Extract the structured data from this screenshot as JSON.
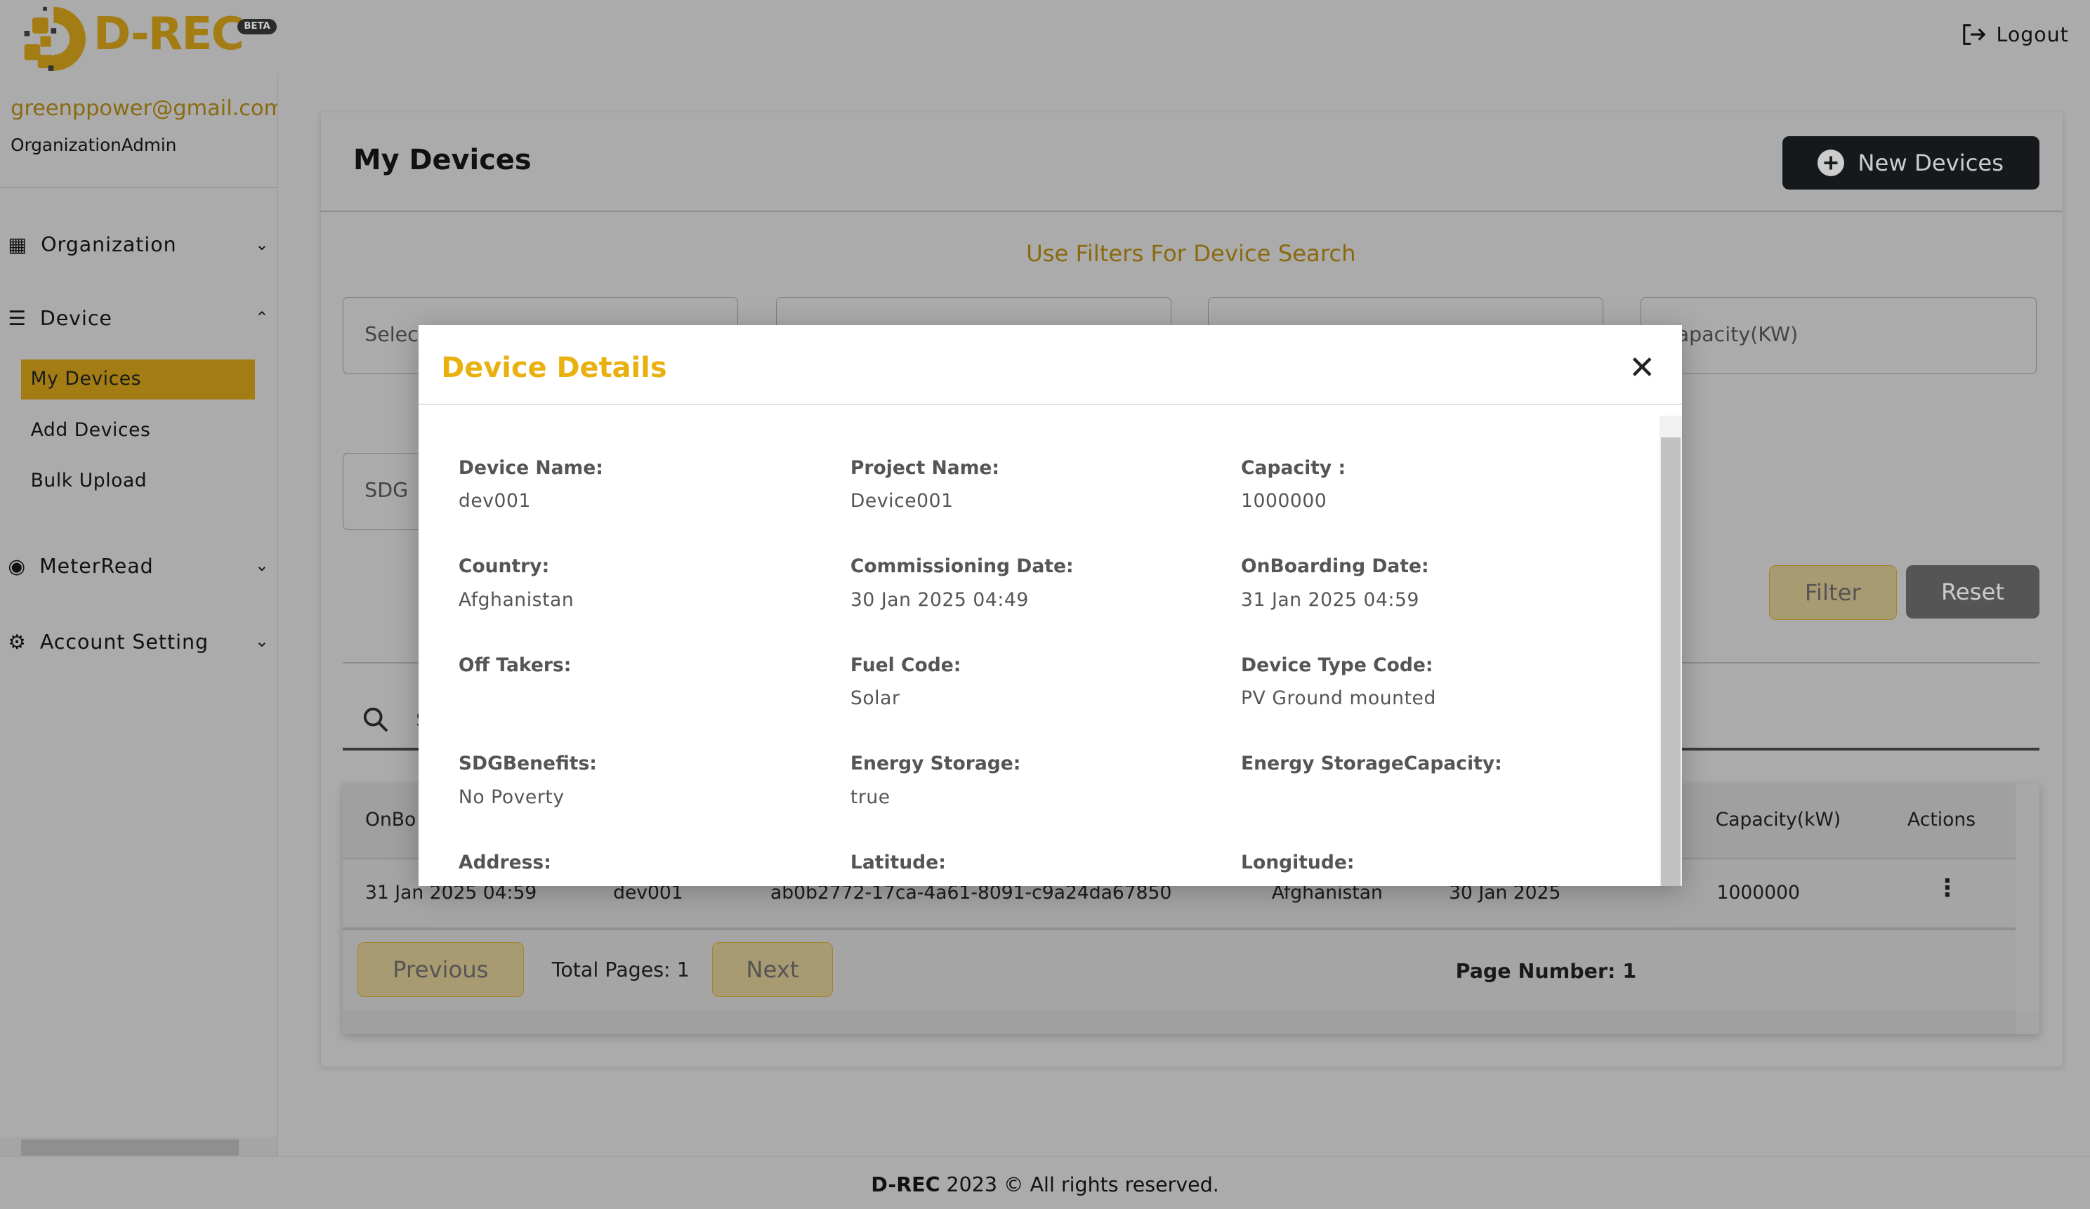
{
  "brand": {
    "name": "D-REC",
    "badge": "BETA"
  },
  "header": {
    "logout": "Logout"
  },
  "user": {
    "email": "greenppower@gmail.com",
    "role": "OrganizationAdmin"
  },
  "sidebar": {
    "items": [
      {
        "label": "Organization",
        "icon": "building-icon",
        "expanded": false
      },
      {
        "label": "Device",
        "icon": "device-icon",
        "expanded": true,
        "children": [
          "My Devices",
          "Add Devices",
          "Bulk Upload"
        ],
        "active": "My Devices"
      },
      {
        "label": "MeterRead",
        "icon": "meter-icon",
        "expanded": false
      },
      {
        "label": "Account Setting",
        "icon": "user-gear-icon",
        "expanded": false
      }
    ]
  },
  "page": {
    "title": "My Devices",
    "new_button": "New Devices",
    "filters_heading": "Use Filters For Device Search",
    "filter_placeholders": [
      "Select",
      "",
      "",
      "Capacity(KW)",
      "SDG"
    ],
    "filter_button": "Filter",
    "reset_button": "Reset",
    "search_placeholder": "S"
  },
  "table": {
    "headers": [
      "OnBoarding Date",
      "",
      "",
      "",
      "",
      "Capacity(kW)",
      "Actions"
    ],
    "header_visible": [
      "OnBo",
      "Capacity(kW)",
      "Actions"
    ],
    "rows": [
      [
        "31 Jan 2025 04:59",
        "dev001",
        "ab0b2772-17ca-4a61-8091-c9a24da67850",
        "Afghanistan",
        "30 Jan 2025",
        "1000000"
      ]
    ],
    "previous": "Previous",
    "total_pages": "Total Pages: 1",
    "next": "Next",
    "page_number_label": "Page Number:",
    "page_number": "1"
  },
  "modal": {
    "title": "Device Details",
    "fields": [
      {
        "label": "Device Name:",
        "value": "dev001"
      },
      {
        "label": "Project Name:",
        "value": "Device001"
      },
      {
        "label": "Capacity :",
        "value": "1000000"
      },
      {
        "label": "Country:",
        "value": "Afghanistan"
      },
      {
        "label": "Commissioning Date:",
        "value": "30 Jan 2025 04:49"
      },
      {
        "label": "OnBoarding Date:",
        "value": "31 Jan 2025 04:59"
      },
      {
        "label": "Off Takers:",
        "value": ""
      },
      {
        "label": "Fuel Code:",
        "value": "Solar"
      },
      {
        "label": "Device Type Code:",
        "value": "PV Ground mounted"
      },
      {
        "label": "SDGBenefits:",
        "value": "No Poverty"
      },
      {
        "label": "Energy Storage:",
        "value": "true"
      },
      {
        "label": "Energy StorageCapacity:",
        "value": ""
      },
      {
        "label": "Address:",
        "value": ""
      },
      {
        "label": "Latitude:",
        "value": ""
      },
      {
        "label": "Longitude:",
        "value": ""
      }
    ]
  },
  "footer": {
    "brand": "D-REC",
    "text": " 2023 © All rights reserved."
  },
  "colors": {
    "accent": "#a37d14",
    "modal_title": "#e9b10f",
    "dark_button": "#16191c"
  }
}
